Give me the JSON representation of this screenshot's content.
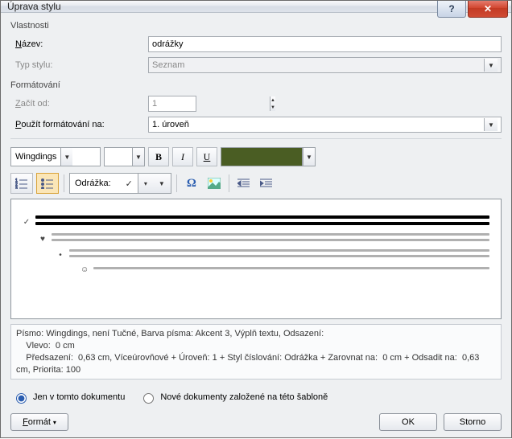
{
  "window": {
    "title": "Úprava stylu"
  },
  "groups": {
    "properties": "Vlastnosti",
    "formatting": "Formátování"
  },
  "properties": {
    "name_label_prefix": "N",
    "name_label_rest": "ázev:",
    "name_value": "odrážky",
    "type_label": "Typ stylu:",
    "type_value": "Seznam"
  },
  "format": {
    "start_label_prefix": "Z",
    "start_label_rest": "ačít od:",
    "start_value": "1",
    "apply_label_prefix": "P",
    "apply_label_rest": "oužít formátování na:",
    "apply_value": "1. úroveň",
    "font_name": "Wingdings",
    "font_size": "",
    "bold": "B",
    "italic": "I",
    "underline": "U",
    "color": "#4a5d23",
    "bullet_label": "Odrážka:",
    "bullet_glyph": "✓",
    "omega": "Ω"
  },
  "preview_bullets": [
    "✓",
    "♥",
    "•",
    "☺"
  ],
  "description": "Písmo: Wingdings, není Tučné, Barva písma: Akcent 3, Výplň textu, Odsazení:\n    Vlevo:  0 cm\n    Předsazení:  0,63 cm, Víceúrovňové + Úroveň: 1 + Styl číslování: Odrážka + Zarovnat na:  0 cm + Odsadit na:  0,63 cm, Priorita: 100",
  "radios": {
    "this_doc": "Jen v tomto dokumentu",
    "new_docs": "Nové dokumenty založené na této šabloně"
  },
  "buttons": {
    "format": "Formát",
    "ok": "OK",
    "cancel": "Storno"
  },
  "titlebar": {
    "help": "?",
    "close": "✕"
  }
}
